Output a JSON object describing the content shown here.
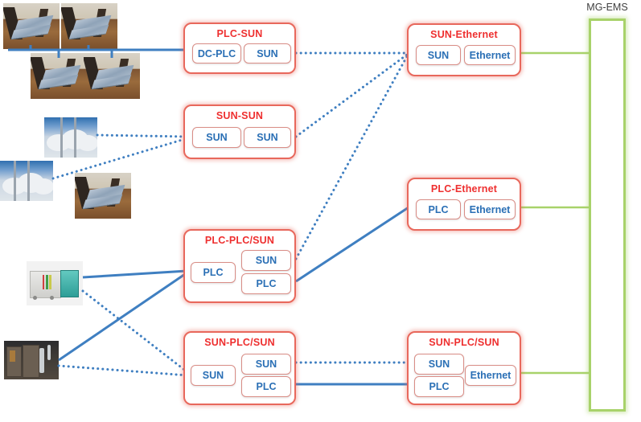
{
  "diagram": {
    "title_label": "MG-EMS",
    "colors": {
      "node_border": "#e8685c",
      "node_title_text": "#ee2f2f",
      "chip_text": "#2a6fb5",
      "solid_link": "#3f7fc1",
      "dotted_link": "#3f7fc1",
      "ems_border": "#a8d26a",
      "ems_link": "#a8d26a",
      "dc_bus": "#3f7fc1"
    },
    "nodes": [
      {
        "id": "plc-sun",
        "title": "PLC-SUN",
        "chips": [
          "DC-PLC",
          "SUN"
        ]
      },
      {
        "id": "sun-ethernet",
        "title": "SUN-Ethernet",
        "chips": [
          "SUN",
          "Ethernet"
        ]
      },
      {
        "id": "sun-sun",
        "title": "SUN-SUN",
        "chips": [
          "SUN",
          "SUN"
        ]
      },
      {
        "id": "plc-ethernet",
        "title": "PLC-Ethernet",
        "chips": [
          "PLC",
          "Ethernet"
        ]
      },
      {
        "id": "plc-plc-sun",
        "title": "PLC-PLC/SUN",
        "chips": [
          "PLC",
          "SUN",
          "PLC"
        ]
      },
      {
        "id": "sun-plc-sun-left",
        "title": "SUN-PLC/SUN",
        "chips": [
          "SUN",
          "SUN",
          "PLC"
        ]
      },
      {
        "id": "sun-plc-sun-right",
        "title": "SUN-PLC/SUN",
        "chips": [
          "SUN",
          "PLC",
          "Ethernet"
        ]
      }
    ],
    "photos": [
      {
        "id": "solar-panel-1",
        "alt": "solar-panel-photo"
      },
      {
        "id": "solar-panel-2",
        "alt": "solar-panel-photo"
      },
      {
        "id": "solar-panel-3",
        "alt": "solar-panel-photo"
      },
      {
        "id": "solar-panel-4",
        "alt": "solar-panel-photo"
      },
      {
        "id": "sky-pole-1",
        "alt": "cloudy-sky-pole-photo"
      },
      {
        "id": "sky-pole-2",
        "alt": "cloudy-sky-pole-photo"
      },
      {
        "id": "solar-panel-5",
        "alt": "solar-panel-photo"
      },
      {
        "id": "cabinet",
        "alt": "outdoor-cabinet-photo"
      },
      {
        "id": "switchgear",
        "alt": "indoor-switchgear-photo"
      }
    ]
  }
}
